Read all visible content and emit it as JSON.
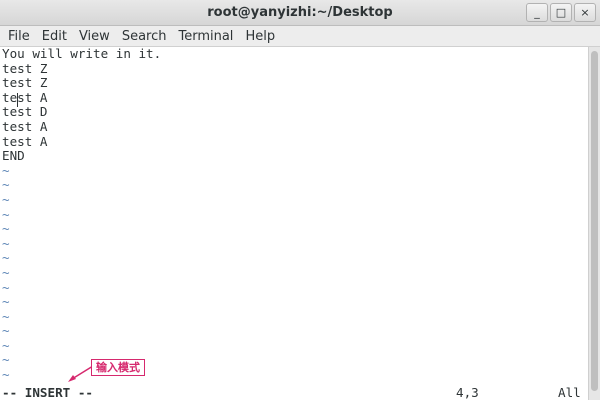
{
  "window": {
    "title": "root@yanyizhi:~/Desktop",
    "minimize_glyph": "_",
    "maximize_glyph": "□",
    "close_glyph": "×"
  },
  "menu": {
    "items": [
      "File",
      "Edit",
      "View",
      "Search",
      "Terminal",
      "Help"
    ]
  },
  "editor": {
    "lines": [
      "You will write in it.",
      "test Z",
      "test Z",
      "test A",
      "test D",
      "test A",
      "test A",
      "END"
    ],
    "tilde_rows": [
      "~",
      "~",
      "~",
      "~",
      "~",
      "~",
      "~",
      "~",
      "~",
      "~",
      "~",
      "~",
      "~",
      "~",
      "~"
    ],
    "cursor": {
      "line": 4,
      "column": 3
    }
  },
  "status_line": {
    "mode": "-- INSERT --",
    "position": "4,3",
    "scroll": "All"
  },
  "annotation": {
    "text": "输入模式",
    "color": "#d6296e"
  },
  "colors": {
    "tilde": "#5f87b7",
    "text": "#2e3436"
  }
}
